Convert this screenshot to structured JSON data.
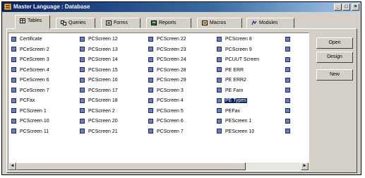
{
  "window": {
    "title": "Master Language : Database"
  },
  "titlebar_controls": {
    "minimize": "_",
    "maximize": "□",
    "close": "×"
  },
  "tabs": [
    {
      "label": "Tables",
      "icon": "table-icon",
      "active": true
    },
    {
      "label": "Queries",
      "icon": "query-icon"
    },
    {
      "label": "Forms",
      "icon": "form-icon"
    },
    {
      "label": "Reports",
      "icon": "report-icon"
    },
    {
      "label": "Macros",
      "icon": "macro-icon"
    },
    {
      "label": "Modules",
      "icon": "module-icon"
    }
  ],
  "tables": {
    "columns": [
      [
        "Certificate",
        "PCeScreen 2",
        "PCeScreen 3",
        "PCeScreen 4",
        "PCeScreen 6",
        "PCeScreen 7",
        "PCFax",
        "PCScreen 1",
        "PCScreen 10",
        "PCScreen 11"
      ],
      [
        "PCScreen 12",
        "PCScreen 13",
        "PCScreen 14",
        "PCScreen 15",
        "PCScreen 16",
        "PCScreen 17",
        "PCScreen 18",
        "PCScreen 2",
        "PCScreen 20",
        "PCScreen 21"
      ],
      [
        "PCScreen 22",
        "PCScreen 23",
        "PCScreen 24",
        "PCScreen 28",
        "PCScreen 29",
        "PCScreen 3",
        "PCScreen 4",
        "PCScreen 5",
        "PCScreen 6",
        "PCScreen 7"
      ],
      [
        "PCScreen 8",
        "PCScreen 9",
        "PCUUT Screen",
        "PE ERR",
        "PE ERR2",
        "PE Fam",
        "PE Types",
        "PEFax",
        "PEScreen 1",
        "PEScreen 10"
      ],
      [
        "",
        "",
        "",
        "",
        "",
        "",
        "",
        "",
        "",
        ""
      ]
    ],
    "selected": "PE Types"
  },
  "scrollbar": {
    "left_arrow": "◄",
    "right_arrow": "►"
  },
  "buttons": {
    "open": "Open",
    "design": "Design",
    "new": "New"
  }
}
